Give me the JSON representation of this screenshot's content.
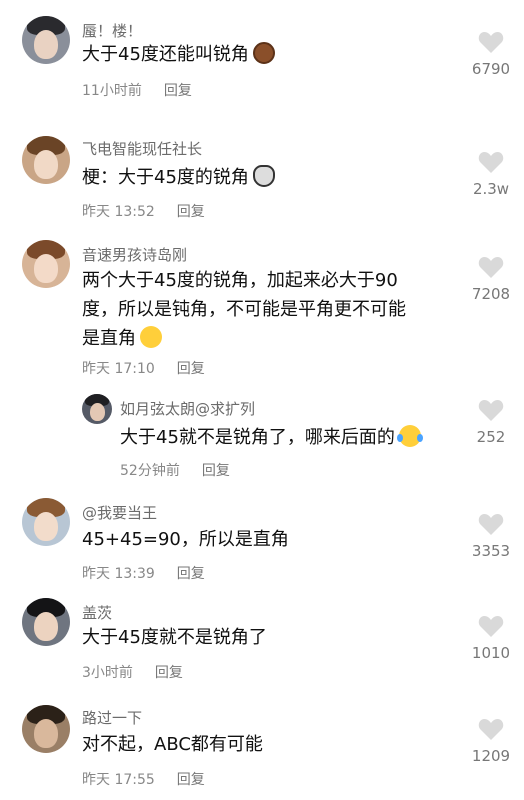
{
  "comments": [
    {
      "username": "蜃！楼！",
      "text": "大于45度还能叫锐角",
      "emoji": "cookie-emoji",
      "time": "11小时前",
      "reply": "回复",
      "likes": "6790"
    },
    {
      "username": "飞电智能现任社长",
      "text": "梗：大于45度的锐角",
      "emoji": "cat-emoji",
      "time": "昨天 13:52",
      "reply": "回复",
      "likes": "2.3w"
    },
    {
      "username": "音速男孩诗岛刚",
      "text_lines": [
        "两个大于45度的锐角，加起来必大于90",
        "度，所以是钝角，不可能是平角更不可能",
        "是直角"
      ],
      "emoji": "laugh-sweat-emoji",
      "time": "昨天 17:10",
      "reply": "回复",
      "likes": "7208"
    },
    {
      "username": "如月弦太朗@求扩列",
      "text": "大于45就不是锐角了，哪来后面的",
      "emoji": "laugh-cry-emoji",
      "time": "52分钟前",
      "reply": "回复",
      "likes": "252"
    },
    {
      "username": "@我要当王",
      "text": "45+45=90，所以是直角",
      "time": "昨天 13:39",
      "reply": "回复",
      "likes": "3353"
    },
    {
      "username": "盖茨",
      "text": "大于45度就不是锐角了",
      "time": "3小时前",
      "reply": "回复",
      "likes": "1010"
    },
    {
      "username": "路过一下",
      "text": "对不起，ABC都有可能",
      "time": "昨天 17:55",
      "reply": "回复",
      "likes": "1209"
    }
  ],
  "colors": {
    "heart": "#d9d9d9",
    "meta": "#888888",
    "username": "#6b6b6b"
  }
}
